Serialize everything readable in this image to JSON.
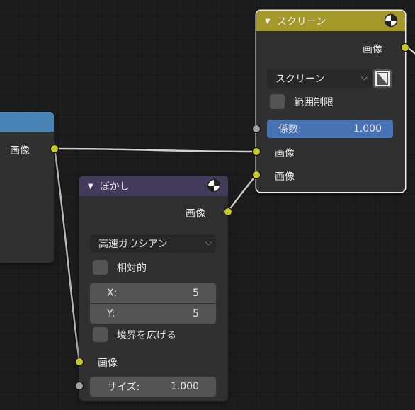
{
  "colors": {
    "screen_header": "#a5982b",
    "blur_header": "#443a5c",
    "left_header": "#4a84b6",
    "socket_color": "#c7c729",
    "socket_value": "#a1a1a1",
    "factor_field": "#4772b3"
  },
  "screen_node": {
    "title": "スクリーン",
    "output_label": "画像",
    "blend_mode": "スクリーン",
    "clamp_label": "範囲制限",
    "factor_label": "係数:",
    "factor_value": "1.000",
    "input1_label": "画像",
    "input2_label": "画像"
  },
  "left_node": {
    "output_label": "画像"
  },
  "blur_node": {
    "title": "ぼかし",
    "output_label": "画像",
    "filter_type": "高速ガウシアン",
    "relative_label": "相対的",
    "x_label": "X:",
    "x_value": "5",
    "y_label": "Y:",
    "y_value": "5",
    "extend_bounds_label": "境界を広げる",
    "input_label": "画像",
    "size_label": "サイズ:",
    "size_value": "1.000"
  }
}
